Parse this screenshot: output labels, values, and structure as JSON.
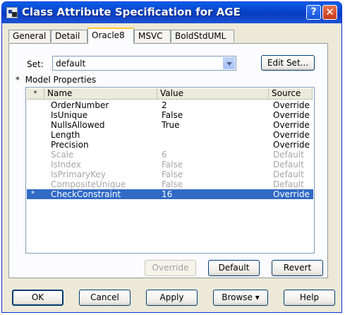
{
  "window": {
    "title": "Class Attribute Specification for AGE"
  },
  "titlebar": {
    "help_label": "?",
    "close_label": "✕"
  },
  "tabs": [
    {
      "label": "General"
    },
    {
      "label": "Detail"
    },
    {
      "label": "Oracle8"
    },
    {
      "label": "MSVC"
    },
    {
      "label": "BoldStdUML"
    }
  ],
  "set": {
    "label": "Set:",
    "value": "default",
    "edit_label": "Edit Set..."
  },
  "model_properties": {
    "marker": "*",
    "label": "Model Properties"
  },
  "grid": {
    "headers": {
      "marker": "*",
      "name": "Name",
      "value": "Value",
      "source": "Source"
    },
    "rows": [
      {
        "marker": "",
        "name": "OrderNumber",
        "value": "2",
        "source": "Override"
      },
      {
        "marker": "",
        "name": "IsUnique",
        "value": "False",
        "source": "Override"
      },
      {
        "marker": "",
        "name": "NullsAllowed",
        "value": "True",
        "source": "Override"
      },
      {
        "marker": "",
        "name": "Length",
        "value": "",
        "source": "Override"
      },
      {
        "marker": "",
        "name": "Precision",
        "value": "",
        "source": "Override"
      },
      {
        "marker": "",
        "name": "Scale",
        "value": "6",
        "source": "Default"
      },
      {
        "marker": "",
        "name": "IsIndex",
        "value": "False",
        "source": "Default"
      },
      {
        "marker": "",
        "name": "IsPrimaryKey",
        "value": "False",
        "source": "Default"
      },
      {
        "marker": "",
        "name": "CompositeUnique",
        "value": "False",
        "source": "Default"
      },
      {
        "marker": "*",
        "name": "CheckConstraint",
        "value": "16",
        "source": "Override"
      }
    ]
  },
  "panel_buttons": {
    "override": "Override",
    "default": "Default",
    "revert": "Revert"
  },
  "footer": {
    "ok": "OK",
    "cancel": "Cancel",
    "apply": "Apply",
    "browse": "Browse ▾",
    "help": "Help"
  }
}
